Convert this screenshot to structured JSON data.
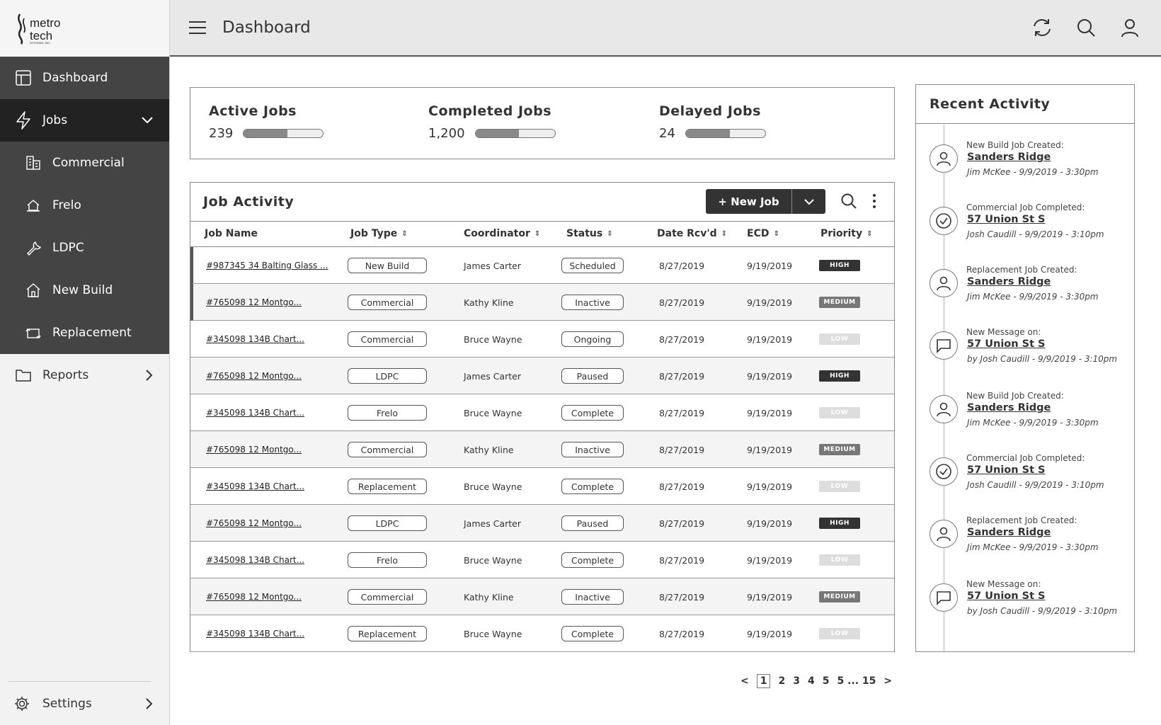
{
  "brand": {
    "name": "metro tech",
    "tagline": "SYSTEMS, INC."
  },
  "header": {
    "title": "Dashboard"
  },
  "sidebar": {
    "items": [
      {
        "label": "Dashboard"
      },
      {
        "label": "Jobs"
      },
      {
        "label": "Commercial"
      },
      {
        "label": "Frelo"
      },
      {
        "label": "LDPC"
      },
      {
        "label": "New Build"
      },
      {
        "label": "Replacement"
      },
      {
        "label": "Reports"
      }
    ],
    "settings": "Settings"
  },
  "stats": [
    {
      "label": "Active Jobs",
      "value": "239",
      "progress": 0.55
    },
    {
      "label": "Completed Jobs",
      "value": "1,200",
      "progress": 0.55
    },
    {
      "label": "Delayed Jobs",
      "value": "24",
      "progress": 0.55
    }
  ],
  "job_activity": {
    "title": "Job Activity",
    "new_job_label": "+ New Job",
    "columns": [
      "Job Name",
      "Job Type",
      "Coordinator",
      "Status",
      "Date Rcv'd",
      "ECD",
      "Priority"
    ],
    "rows": [
      {
        "name": "#987345 34 Balting Glass ...",
        "type": "New Build",
        "coordinator": "James Carter",
        "status": "Scheduled",
        "date": "8/27/2019",
        "ecd": "9/19/2019",
        "priority": "HIGH"
      },
      {
        "name": "#765098 12 Montgo...",
        "type": "Commercial",
        "coordinator": "Kathy Kline",
        "status": "Inactive",
        "date": "8/27/2019",
        "ecd": "9/19/2019",
        "priority": "MEDIUM"
      },
      {
        "name": "#345098 134B Chart...",
        "type": "Commercial",
        "coordinator": "Bruce Wayne",
        "status": "Ongoing",
        "date": "8/27/2019",
        "ecd": "9/19/2019",
        "priority": "LOW"
      },
      {
        "name": "#765098 12 Montgo...",
        "type": "LDPC",
        "coordinator": "James Carter",
        "status": "Paused",
        "date": "8/27/2019",
        "ecd": "9/19/2019",
        "priority": "HIGH"
      },
      {
        "name": "#345098 134B Chart...",
        "type": "Frelo",
        "coordinator": "Bruce Wayne",
        "status": "Complete",
        "date": "8/27/2019",
        "ecd": "9/19/2019",
        "priority": "LOW"
      },
      {
        "name": "#765098 12 Montgo...",
        "type": "Commercial",
        "coordinator": "Kathy Kline",
        "status": "Inactive",
        "date": "8/27/2019",
        "ecd": "9/19/2019",
        "priority": "MEDIUM"
      },
      {
        "name": "#345098 134B Chart...",
        "type": "Replacement",
        "coordinator": "Bruce Wayne",
        "status": "Complete",
        "date": "8/27/2019",
        "ecd": "9/19/2019",
        "priority": "LOW"
      },
      {
        "name": "#765098 12 Montgo...",
        "type": "LDPC",
        "coordinator": "James Carter",
        "status": "Paused",
        "date": "8/27/2019",
        "ecd": "9/19/2019",
        "priority": "HIGH"
      },
      {
        "name": "#345098 134B Chart...",
        "type": "Frelo",
        "coordinator": "Bruce Wayne",
        "status": "Complete",
        "date": "8/27/2019",
        "ecd": "9/19/2019",
        "priority": "LOW"
      },
      {
        "name": "#765098 12 Montgo...",
        "type": "Commercial",
        "coordinator": "Kathy Kline",
        "status": "Inactive",
        "date": "8/27/2019",
        "ecd": "9/19/2019",
        "priority": "MEDIUM"
      },
      {
        "name": "#345098 134B Chart...",
        "type": "Replacement",
        "coordinator": "Bruce Wayne",
        "status": "Complete",
        "date": "8/27/2019",
        "ecd": "9/19/2019",
        "priority": "LOW"
      }
    ]
  },
  "pagination": {
    "prev": "<",
    "pages": [
      "1",
      "2",
      "3",
      "4",
      "5",
      "5 ... 15"
    ],
    "next": ">",
    "current": "1"
  },
  "recent_activity": {
    "title": "Recent Activity",
    "items": [
      {
        "icon": "user-icon",
        "label": "New Build Job Created:",
        "link": "Sanders Ridge",
        "meta": "Jim McKee - 9/9/2019 - 3:30pm"
      },
      {
        "icon": "check-circle-icon",
        "label": "Commercial Job Completed:",
        "link": "57 Union St S",
        "meta": "Josh Caudill - 9/9/2019 - 3:10pm"
      },
      {
        "icon": "user-icon",
        "label": "Replacement Job Created:",
        "link": "Sanders Ridge",
        "meta": "Jim McKee - 9/9/2019 - 3:30pm"
      },
      {
        "icon": "message-icon",
        "label": "New Message on:",
        "link": "57 Union St S",
        "meta": "by Josh Caudill - 9/9/2019 - 3:10pm"
      },
      {
        "icon": "user-icon",
        "label": "New Build Job Created:",
        "link": "Sanders Ridge",
        "meta": "Jim McKee - 9/9/2019 - 3:30pm"
      },
      {
        "icon": "check-circle-icon",
        "label": "Commercial Job Completed:",
        "link": "57 Union St S",
        "meta": "Josh Caudill - 9/9/2019 - 3:10pm"
      },
      {
        "icon": "user-icon",
        "label": "Replacement Job Created:",
        "link": "Sanders Ridge",
        "meta": "Jim McKee - 9/9/2019 - 3:30pm"
      },
      {
        "icon": "message-icon",
        "label": "New Message on:",
        "link": "57 Union St S",
        "meta": "by Josh Caudill - 9/9/2019 - 3:10pm"
      }
    ]
  }
}
